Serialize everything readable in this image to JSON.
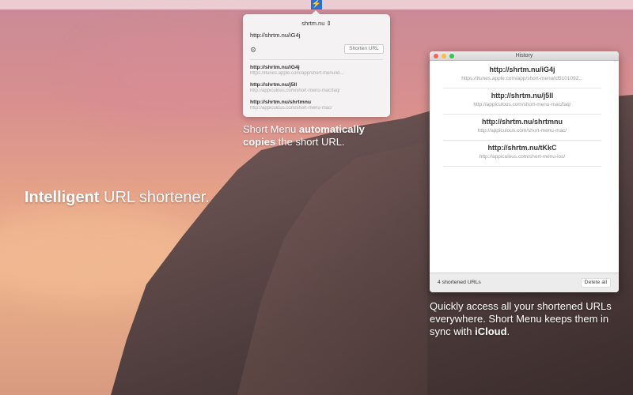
{
  "menubar": {
    "icon": "lightning-bolt-icon"
  },
  "popover": {
    "service": "shrtm.nu",
    "url_input": "http://shrtm.nu/iG4j",
    "shorten_label": "Shorten URL",
    "items": [
      {
        "short": "http://shrtm.nu/iG4j",
        "long": "https://itunes.apple.com/app/short-menu/id..."
      },
      {
        "short": "http://shrtm.nu/j5ll",
        "long": "http://appiculous.com/short-menu-mac/faq/"
      },
      {
        "short": "http://shrtm.nu/shrtmnu",
        "long": "http://appiculous.com/short-menu-mac/"
      }
    ]
  },
  "captions": {
    "main_bold": "Intelligent",
    "main_rest": " URL shortener.",
    "popover_1": "Short Menu ",
    "popover_bold1": "automatically",
    "popover_bold2": "copies",
    "popover_2": " the short URL.",
    "history_1": "Quickly access all your shortened URLs everywhere. Short Menu keeps them in sync with ",
    "history_bold": "iCloud",
    "history_2": "."
  },
  "history": {
    "title": "History",
    "items": [
      {
        "short": "http://shrtm.nu/iG4j",
        "long": "https://itunes.apple.com/app/short-menu/id5101092..."
      },
      {
        "short": "http://shrtm.nu/j5ll",
        "long": "http://appiculous.com/short-menu-mac/faq/"
      },
      {
        "short": "http://shrtm.nu/shrtmnu",
        "long": "http://appiculous.com/short-menu-mac/"
      },
      {
        "short": "http://shrtm.nu/tKkC",
        "long": "http://appiculous.com/short-menu-ios/"
      }
    ],
    "count": "4 shortened URLs",
    "delete_label": "Delete all"
  }
}
